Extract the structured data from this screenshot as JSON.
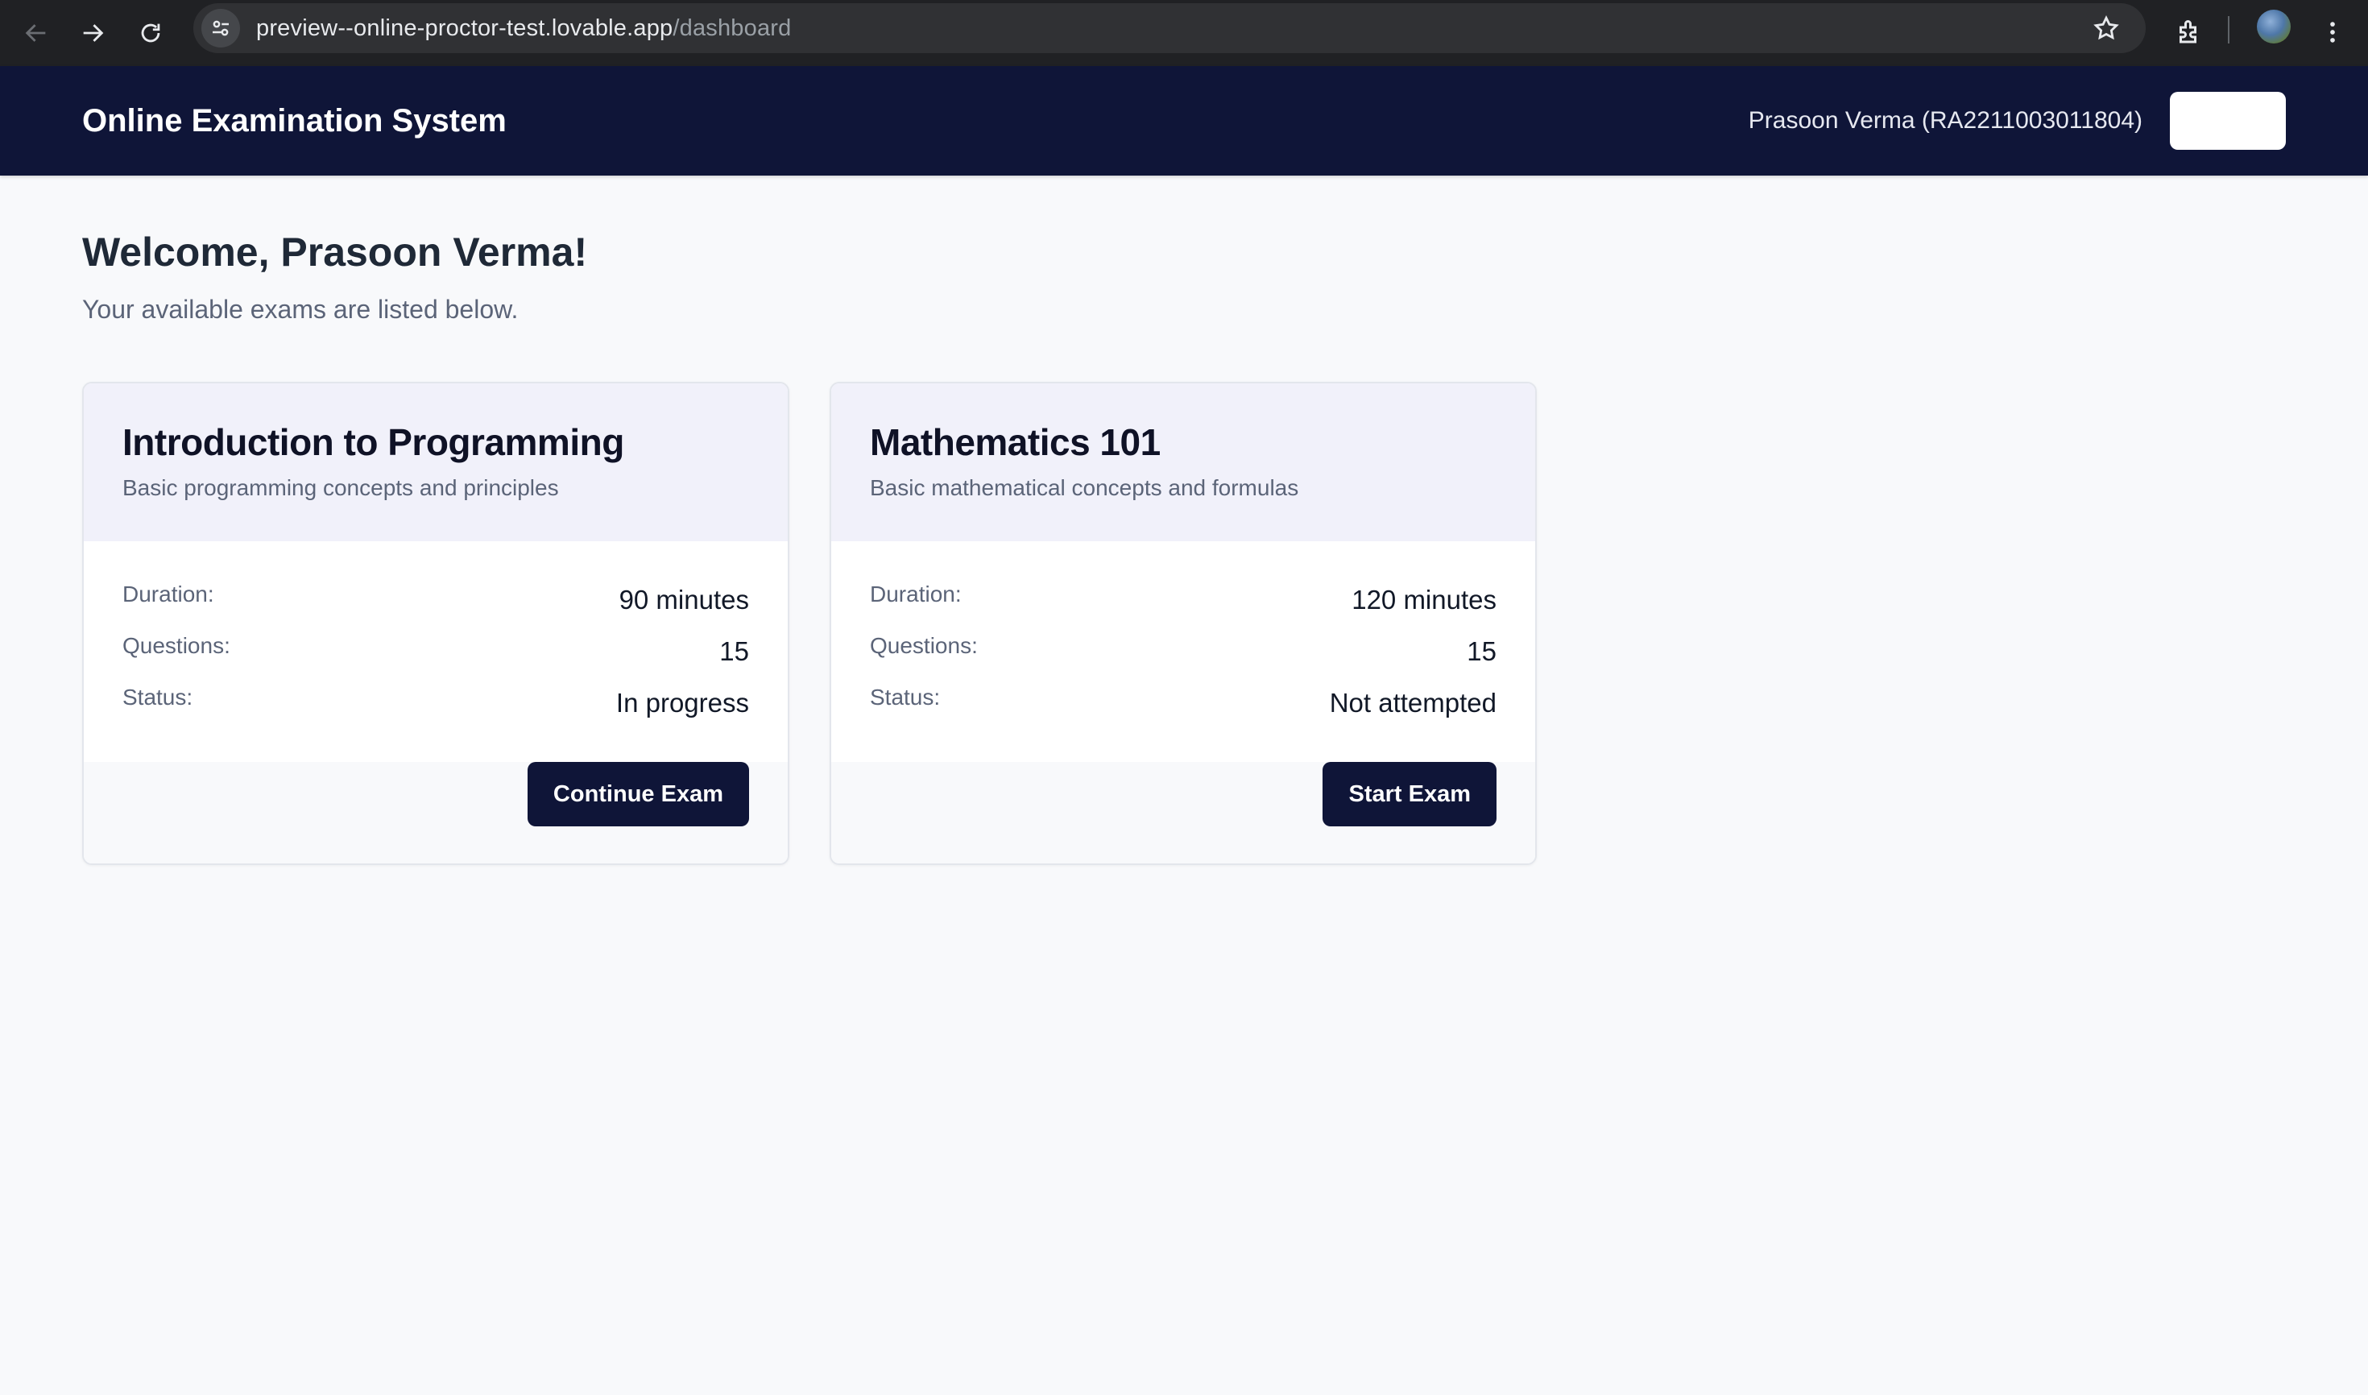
{
  "browser": {
    "url_host": "preview--online-proctor-test.lovable.app",
    "url_path": "/dashboard"
  },
  "header": {
    "title": "Online Examination System",
    "user": "Prasoon Verma (RA2211003011804)",
    "logout_label": ""
  },
  "main": {
    "welcome": "Welcome, Prasoon Verma!",
    "subtitle": "Your available exams are listed below."
  },
  "exams": [
    {
      "title": "Introduction to Programming",
      "description": "Basic programming concepts and principles",
      "duration_label": "Duration:",
      "duration": "90 minutes",
      "questions_label": "Questions:",
      "questions": "15",
      "status_label": "Status:",
      "status": "In progress",
      "action": "Continue Exam"
    },
    {
      "title": "Mathematics 101",
      "description": "Basic mathematical concepts and formulas",
      "duration_label": "Duration:",
      "duration": "120 minutes",
      "questions_label": "Questions:",
      "questions": "15",
      "status_label": "Status:",
      "status": "Not attempted",
      "action": "Start Exam"
    }
  ],
  "colors": {
    "header_bg": "#0f1538",
    "page_bg": "#f8f9fb",
    "card_head_bg": "#f1f1fa",
    "button_bg": "#0f1538"
  }
}
